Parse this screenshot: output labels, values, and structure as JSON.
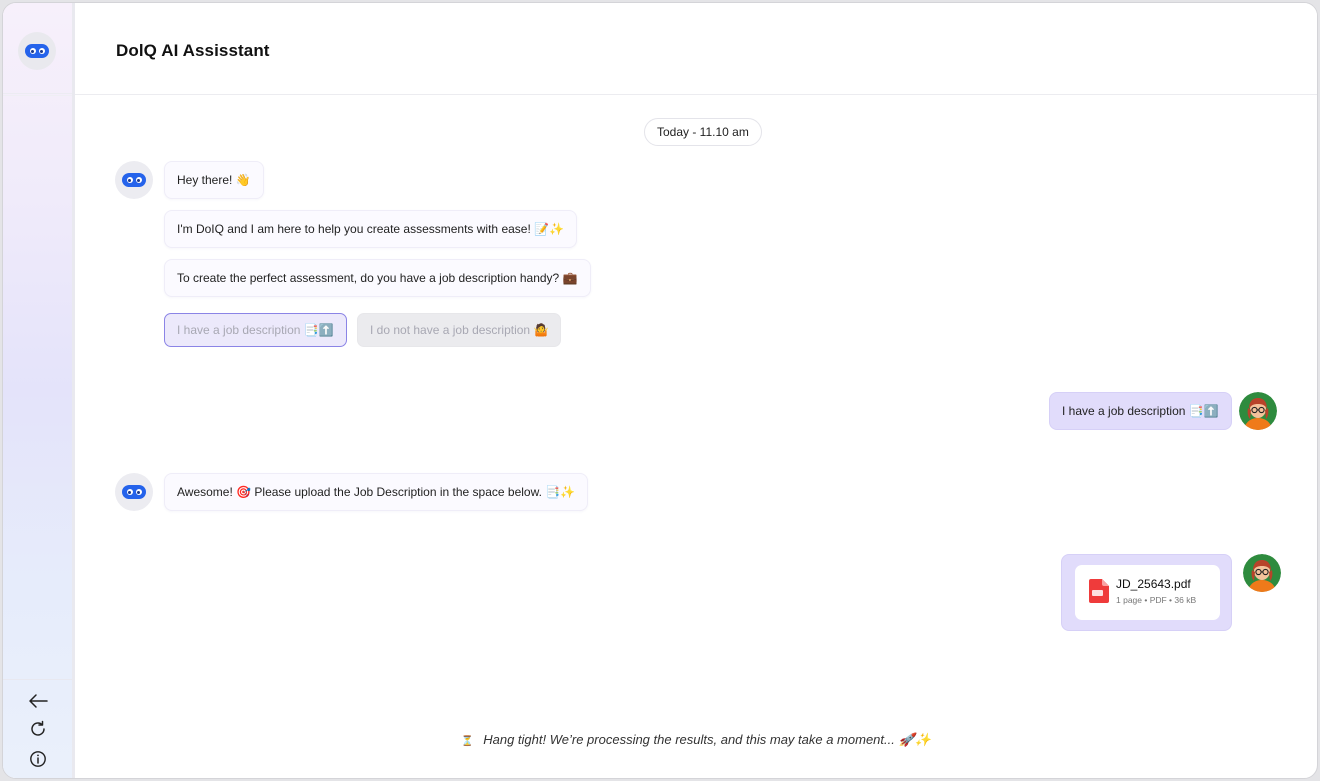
{
  "app": {
    "title": "DolQ AI Assisstant"
  },
  "sidebar": {
    "icons": [
      "bot-logo-icon",
      "back-arrow-icon",
      "refresh-icon",
      "info-icon"
    ]
  },
  "chat": {
    "date_label": "Today - 11.10 am",
    "bot_messages": [
      "Hey there! 👋",
      "I'm DoIQ and I am here to help you create assessments with ease! 📝✨",
      "To create the perfect assessment, do you have a job description handy? 💼"
    ],
    "options": [
      "I have a job description 📑⬆️",
      "I do not have a job description 🤷"
    ],
    "user_reply": "I have a job description 📑⬆️",
    "bot_followup": "Awesome! 🎯 Please upload the Job Description in the space below. 📑✨",
    "file": {
      "name": "JD_25643.pdf",
      "meta": "1 page • PDF • 36 kB",
      "icon": "pdf-file-icon"
    },
    "status": "Hang tight! We’re processing the results, and this may take a moment... 🚀✨",
    "status_icon": "⏳"
  },
  "colors": {
    "accent": "#2563eb",
    "user_bubble": "#e1dcfb",
    "selected_option_border": "#8b84e6"
  }
}
